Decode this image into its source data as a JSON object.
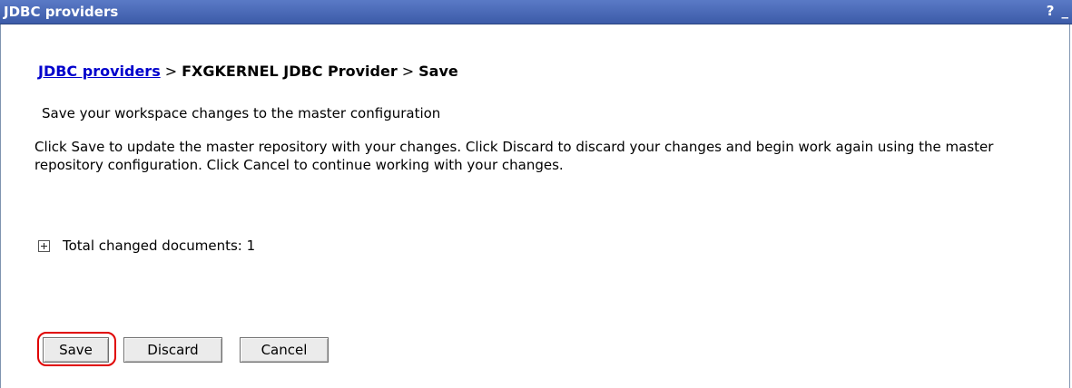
{
  "titlebar": {
    "title": "JDBC providers",
    "help_label": "?",
    "minimize_label": "_"
  },
  "breadcrumb": {
    "link": "JDBC providers",
    "separator": ">",
    "provider": "FXGKERNEL JDBC Provider",
    "current": "Save"
  },
  "subtitle": "Save your workspace changes to the master configuration",
  "description": "Click Save to update the master repository with your changes. Click Discard to discard your changes and begin work again using the master repository configuration. Click Cancel to continue working with your changes.",
  "changes": {
    "label": "Total changed documents: 1"
  },
  "buttons": {
    "save": "Save",
    "discard": "Discard",
    "cancel": "Cancel"
  },
  "colors": {
    "title_bar": "#4766b5",
    "link": "#0000cc",
    "highlight": "#e00000"
  }
}
